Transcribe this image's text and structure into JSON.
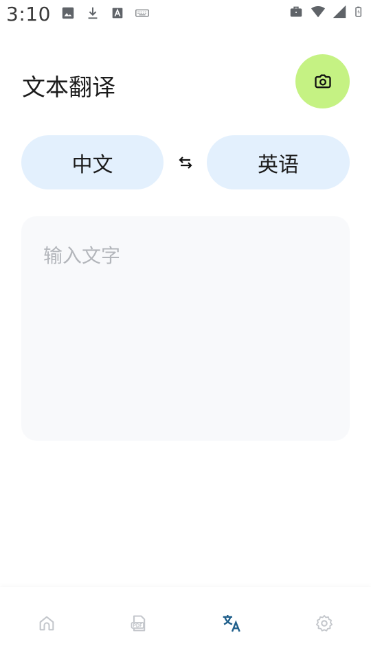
{
  "status_bar": {
    "time": "3:10",
    "left_icons": [
      "image-icon",
      "download-icon",
      "text-a-icon",
      "keyboard-icon"
    ],
    "right_icons": [
      "briefcase-icon",
      "wifi-icon",
      "signal-icon",
      "battery-icon"
    ]
  },
  "header": {
    "title": "文本翻译",
    "camera_icon": "camera-icon"
  },
  "languages": {
    "source": "中文",
    "target": "英语",
    "swap_icon": "swap-arrows-icon"
  },
  "input": {
    "placeholder": "输入文字",
    "value": ""
  },
  "bottom_nav": {
    "items": [
      {
        "icon": "home-icon",
        "active": false
      },
      {
        "icon": "pdf-icon",
        "active": false
      },
      {
        "icon": "translate-icon",
        "active": true
      },
      {
        "icon": "gear-icon",
        "active": false
      }
    ]
  },
  "colors": {
    "accent_green": "#c5f283",
    "pill_blue": "#e3f0fd",
    "input_bg": "#f8f9fb",
    "nav_active": "#1f5f8b",
    "nav_inactive": "#c4c7cc"
  }
}
